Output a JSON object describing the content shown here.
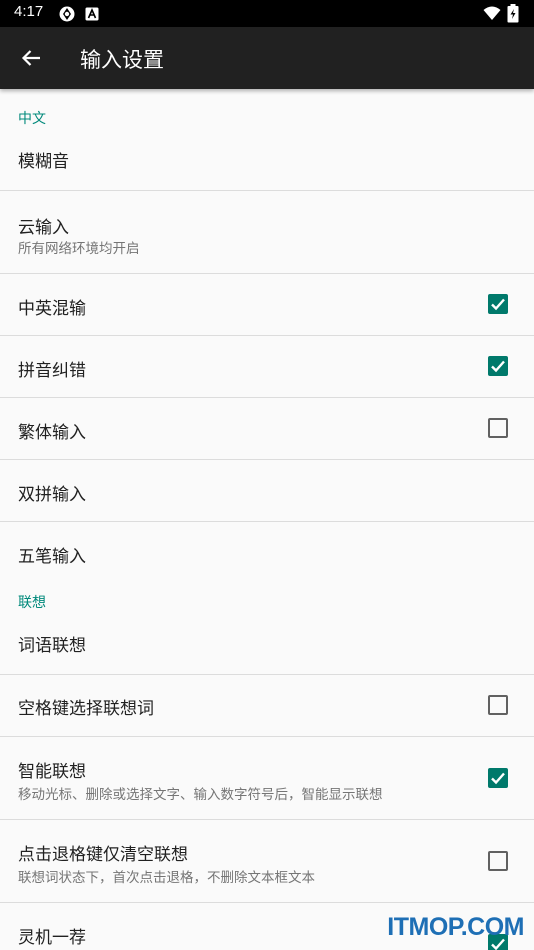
{
  "status_bar": {
    "time": "4:17"
  },
  "app_bar": {
    "title": "输入设置"
  },
  "sections": [
    {
      "category": "中文",
      "items": [
        {
          "title": "模糊音"
        },
        {
          "title": "云输入",
          "summary": "所有网络环境均开启"
        },
        {
          "title": "中英混输",
          "checked": true
        },
        {
          "title": "拼音纠错",
          "checked": true
        },
        {
          "title": "繁体输入",
          "checked": false
        },
        {
          "title": "双拼输入"
        },
        {
          "title": "五笔输入"
        }
      ]
    },
    {
      "category": "联想",
      "items": [
        {
          "title": "词语联想"
        },
        {
          "title": "空格键选择联想词",
          "checked": false
        },
        {
          "title": "智能联想",
          "summary": "移动光标、删除或选择文字、输入数字符号后，智能显示联想",
          "checked": true
        },
        {
          "title": "点击退格键仅清空联想",
          "summary": "联想词状态下，首次点击退格，不删除文本框文本",
          "checked": false
        },
        {
          "title": "灵机一荐",
          "checked": true
        }
      ]
    }
  ],
  "watermark": "ITMOP.COM",
  "colors": {
    "accent": "#00897b",
    "checkbox": "#00796b",
    "toolbar": "#212121"
  }
}
